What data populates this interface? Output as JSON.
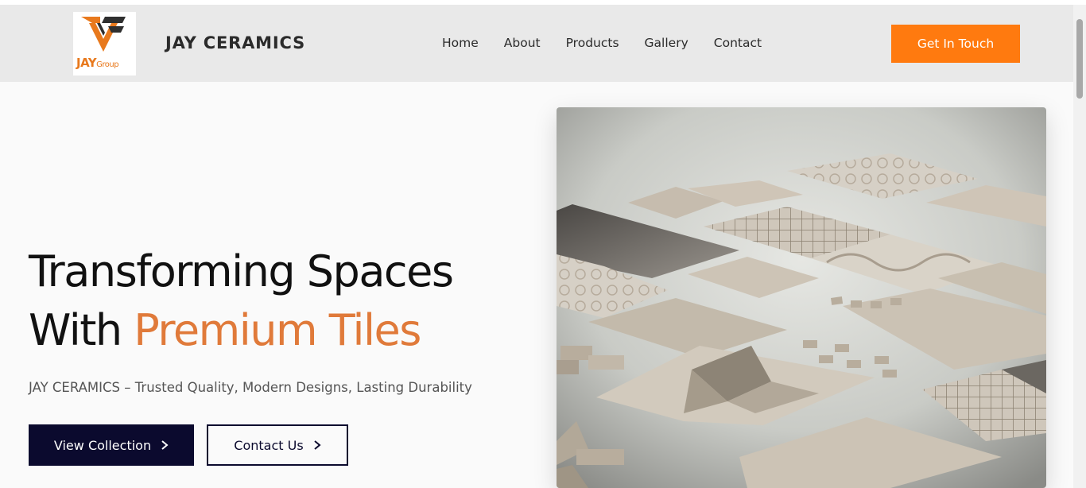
{
  "header": {
    "logo_text": "JAY",
    "logo_subtext": "Group",
    "brand_name": "JAY CERAMICS",
    "nav": [
      "Home",
      "About",
      "Products",
      "Gallery",
      "Contact"
    ],
    "cta_label": "Get In Touch"
  },
  "hero": {
    "headline_line1": "Transforming Spaces",
    "headline_line2_prefix": "With",
    "headline_line2_accent": "Premium Tiles",
    "subtitle": "JAY CERAMICS – Trusted Quality, Modern Designs, Lasting Durability",
    "primary_button": "View Collection",
    "secondary_button": "Contact Us"
  },
  "colors": {
    "accent": "#ff7a0f",
    "headline_accent": "#e07a3a",
    "navy": "#0b0a2e"
  },
  "icons": {
    "button_chevron": "chevron-right-icon"
  }
}
